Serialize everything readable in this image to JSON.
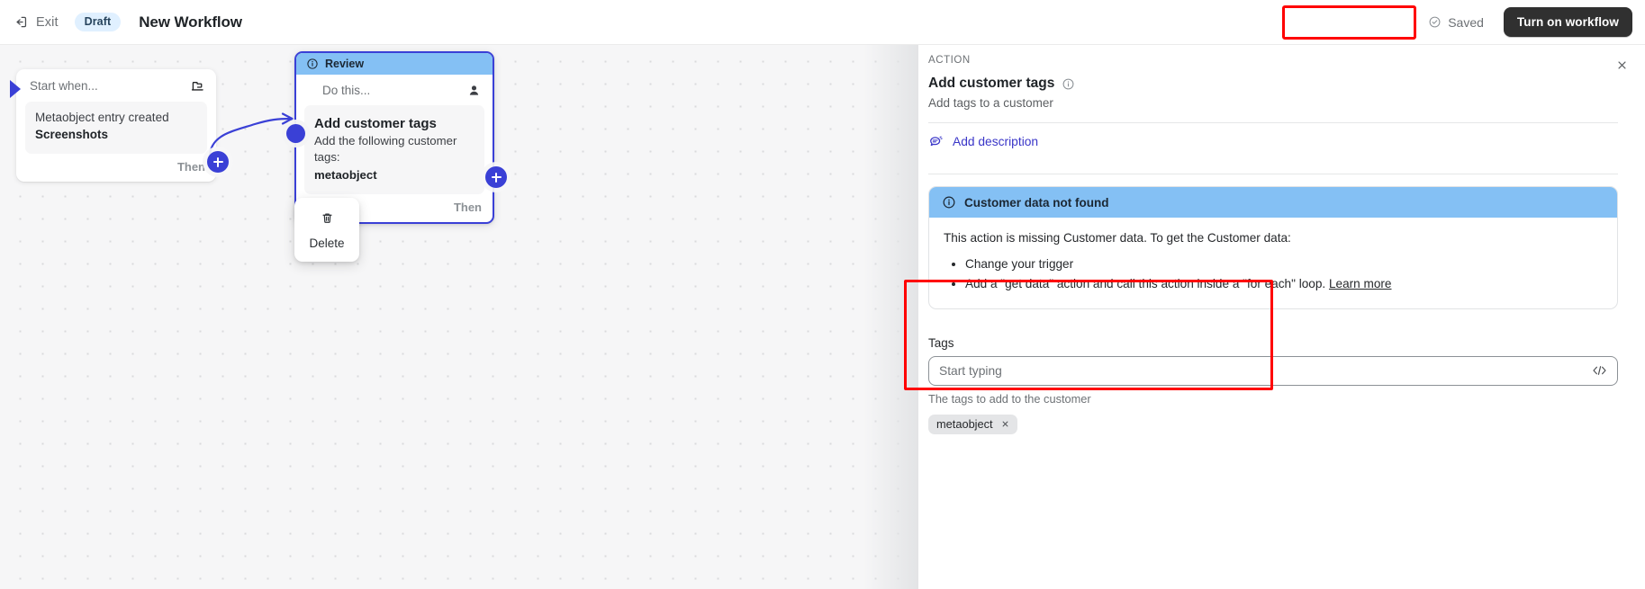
{
  "topbar": {
    "exit_label": "Exit",
    "status_badge": "Draft",
    "workflow_title": "New Workflow",
    "saved_label": "Saved",
    "turn_on_label": "Turn on workflow",
    "exit_icon": "exit-icon",
    "saved_icon": "check-circle-icon"
  },
  "canvas": {
    "trigger": {
      "header_label": "Start when...",
      "header_icon": "flag-icon",
      "line1": "Metaobject entry created",
      "line2": "Screenshots",
      "then_label": "Then",
      "add_icon": "plus-icon"
    },
    "action": {
      "review_label": "Review",
      "review_icon": "info-circle-icon",
      "header_label": "Do this...",
      "header_icon": "customer-icon",
      "title": "Add customer tags",
      "description": "Add the following customer tags:",
      "tag_value": "metaobject",
      "then_label": "Then",
      "add_icon": "plus-icon"
    },
    "context_menu": {
      "delete_label": "Delete",
      "delete_icon": "trash-icon"
    }
  },
  "panel": {
    "eyebrow": "ACTION",
    "title": "Add customer tags",
    "title_info_icon": "info-circle-icon",
    "subtitle": "Add tags to a customer",
    "close_icon": "close-icon",
    "add_description": {
      "label": "Add description",
      "icon": "comment-icon"
    },
    "notice": {
      "icon": "info-circle-icon",
      "heading": "Customer data not found",
      "body": "This action is missing Customer data. To get the Customer data:",
      "bullets": [
        "Change your trigger",
        "Add a \"get data\" action and call this action inside a \"for each\" loop."
      ],
      "link_label": "Learn more"
    },
    "tags_field": {
      "label": "Tags",
      "placeholder": "Start typing",
      "value": "",
      "code_icon": "code-icon",
      "help_text": "The tags to add to the customer",
      "chips": [
        {
          "label": "metaobject",
          "remove_icon": "close-icon"
        }
      ]
    }
  },
  "annotations": {
    "color": "#ff0000",
    "boxes": [
      "turn-on-workflow-button",
      "tags-field-section"
    ]
  }
}
